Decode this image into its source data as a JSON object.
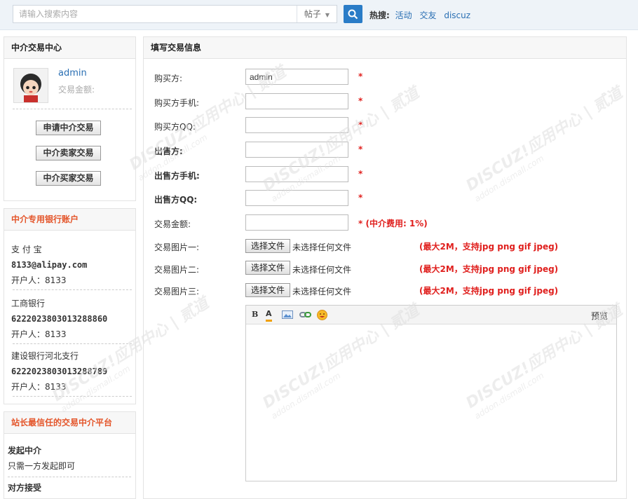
{
  "search": {
    "placeholder": "请输入搜索内容",
    "type": "帖子",
    "hot_label": "热搜:",
    "hot_links": [
      "活动",
      "交友",
      "discuz"
    ]
  },
  "sidebar": {
    "center_title": "中介交易中心",
    "username": "admin",
    "balance_label": "交易金额:",
    "buttons": [
      "申请中介交易",
      "中介卖家交易",
      "中介买家交易"
    ],
    "bank_title": "中介专用银行账户",
    "banks": [
      {
        "name": "支 付 宝",
        "account": "8133@alipay.com",
        "holder": "开户人：8133"
      },
      {
        "name": "工商银行",
        "account": "6222023803013288860",
        "holder": "开户人：8133"
      },
      {
        "name": "建设银行河北支行",
        "account": "6222023803013288789",
        "holder": "开户人：8133"
      }
    ],
    "platform_title": "站长最信任的交易中介平台",
    "steps": [
      {
        "title": "发起中介",
        "desc": "只需一方发起即可"
      },
      {
        "title": "对方接受",
        "desc": ""
      }
    ]
  },
  "form": {
    "title": "填写交易信息",
    "fields": [
      {
        "label": "购买方:",
        "value": "admin",
        "required": "*"
      },
      {
        "label": "购买方手机:",
        "value": "",
        "required": "*"
      },
      {
        "label": "购买方QQ:",
        "value": "",
        "required": "*"
      },
      {
        "label": "出售方:",
        "value": "",
        "required": "*"
      },
      {
        "label": "出售方手机:",
        "value": "",
        "required": "*"
      },
      {
        "label": "出售方QQ:",
        "value": "",
        "required": "*"
      }
    ],
    "amount_label": "交易金额:",
    "amount_note": "* (中介费用: 1%)",
    "images": [
      {
        "label": "交易图片一:"
      },
      {
        "label": "交易图片二:"
      },
      {
        "label": "交易图片三:"
      }
    ],
    "file_button": "选择文件",
    "file_status": "未选择任何文件",
    "file_note": "(最大2M，支持jpg png gif jpeg)",
    "editor": {
      "bold": "B",
      "font_color": "A",
      "preview": "预览"
    }
  },
  "watermark": {
    "text": "DISCUZ!应用中心 | 贰道",
    "sub": "addon.dismall.com"
  },
  "colors": {
    "accent": "#2a7cc7",
    "required": "#e0201e",
    "orange_title": "#e4552a"
  }
}
